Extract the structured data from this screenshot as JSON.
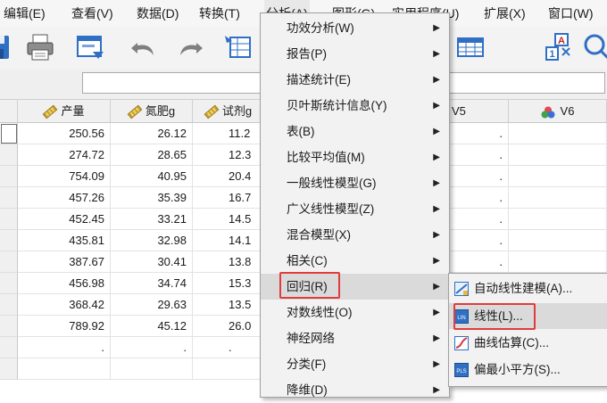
{
  "menubar": {
    "items": [
      "编辑(E)",
      "查看(V)",
      "数据(D)",
      "转换(T)",
      "分析(A)",
      "图形(G)",
      "实用程序(U)",
      "扩展(X)",
      "窗口(W)"
    ]
  },
  "grid": {
    "columns": [
      "产量",
      "氮肥g",
      "试剂g",
      "V5",
      "V6"
    ],
    "rows": [
      [
        "250.56",
        "26.12",
        "11.2"
      ],
      [
        "274.72",
        "28.65",
        "12.3"
      ],
      [
        "754.09",
        "40.95",
        "20.4"
      ],
      [
        "457.26",
        "35.39",
        "16.7"
      ],
      [
        "452.45",
        "33.21",
        "14.5"
      ],
      [
        "435.81",
        "32.98",
        "14.1"
      ],
      [
        "387.67",
        "30.41",
        "13.8"
      ],
      [
        "456.98",
        "34.74",
        "15.3"
      ],
      [
        "368.42",
        "29.63",
        "13.5"
      ],
      [
        "789.92",
        "45.12",
        "26.0"
      ],
      [
        ".",
        ".",
        "."
      ]
    ],
    "missing_mark": "."
  },
  "analyze_menu": {
    "items": [
      "功效分析(W)",
      "报告(P)",
      "描述统计(E)",
      "贝叶斯统计信息(Y)",
      "表(B)",
      "比较平均值(M)",
      "一般线性模型(G)",
      "广义线性模型(Z)",
      "混合模型(X)",
      "相关(C)",
      "回归(R)",
      "对数线性(O)",
      "神经网络",
      "分类(F)",
      "降维(D)"
    ],
    "highlighted": "回归(R)"
  },
  "regression_submenu": {
    "items": [
      "自动线性建模(A)...",
      "线性(L)...",
      "曲线估算(C)...",
      "偏最小平方(S)..."
    ],
    "highlighted": "线性(L)..."
  },
  "icons": {
    "toolbar": [
      "save-icon",
      "print-icon",
      "dialog-recall-icon",
      "undo-icon",
      "redo-icon",
      "goto-case-icon",
      "value-labels-icon",
      "spell-check-icon",
      "grid-icon"
    ],
    "column_types": [
      "scale-ruler-icon",
      "nominal-circles-icon"
    ]
  },
  "colors": {
    "highlight_box": "#e23b3b",
    "menu_bg": "#f2f2f2",
    "menu_highlight": "#dadada",
    "ruler": "#d6a829",
    "nominal_red": "#e34a4a",
    "nominal_green": "#3fa34d",
    "nominal_blue": "#3b6fd6"
  }
}
